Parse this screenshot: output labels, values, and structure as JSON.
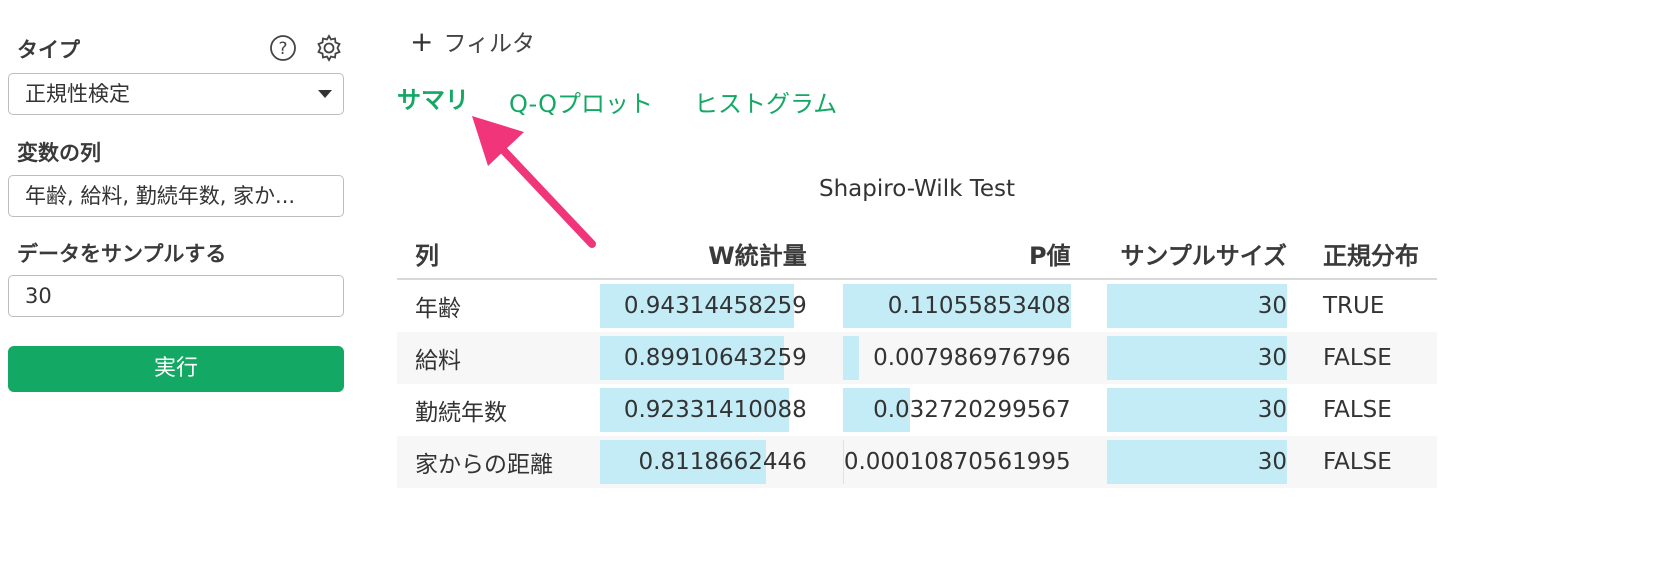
{
  "sidebar": {
    "type_label": "タイプ",
    "type_value": "正規性検定",
    "columns_label": "変数の列",
    "columns_value": "年齢, 給料, 勤続年数, 家か...",
    "sample_label": "データをサンプルする",
    "sample_value": "30",
    "run_label": "実行",
    "icons": [
      "help-icon",
      "gear-icon",
      "dropdown-caret-icon"
    ]
  },
  "toolbar": {
    "filter_label": "フィルタ",
    "filter_icon": "plus-icon"
  },
  "tabs": [
    {
      "label": "サマリ",
      "active": true
    },
    {
      "label": "Q-Qプロット",
      "active": false
    },
    {
      "label": "ヒストグラム",
      "active": false
    }
  ],
  "table": {
    "caption": "Shapiro-Wilk Test",
    "headers": [
      "列",
      "W統計量",
      "P値",
      "サンプルサイズ",
      "正規分布"
    ],
    "rows": [
      {
        "col": "年齢",
        "w": "0.94314458259",
        "p": "0.11055853408",
        "n": "30",
        "normal": "TRUE",
        "w_bar": 0.935,
        "p_bar": 1.0,
        "n_bar": 1.0
      },
      {
        "col": "給料",
        "w": "0.89910643259",
        "p": "0.007986976796",
        "n": "30",
        "normal": "FALSE",
        "w_bar": 0.89,
        "p_bar": 0.072,
        "n_bar": 1.0
      },
      {
        "col": "勤続年数",
        "w": "0.92331410088",
        "p": "0.032720299567",
        "n": "30",
        "normal": "FALSE",
        "w_bar": 0.915,
        "p_bar": 0.296,
        "n_bar": 1.0
      },
      {
        "col": "家からの距離",
        "w": "0.8118662446",
        "p": "0.00010870561995",
        "n": "30",
        "normal": "FALSE",
        "w_bar": 0.8,
        "p_bar": 0.005,
        "n_bar": 1.0
      }
    ]
  },
  "colors": {
    "accent": "#14a865",
    "bar": "#c3ecf7",
    "arrow": "#f0357a"
  }
}
